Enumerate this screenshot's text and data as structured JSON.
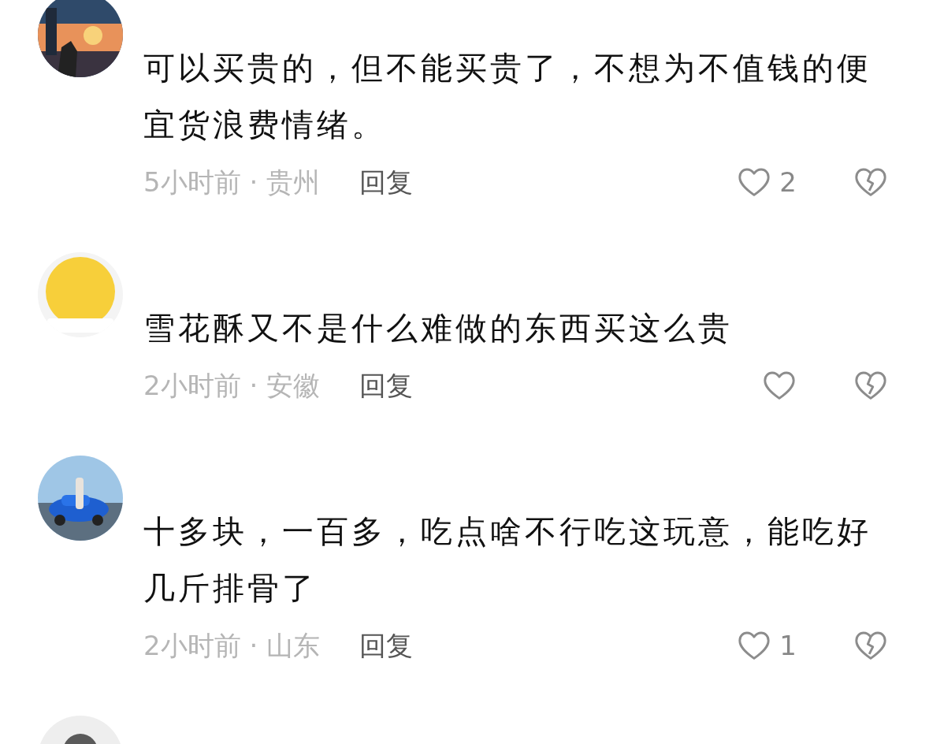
{
  "comments": [
    {
      "text": "可以买贵的，但不能买贵了，不想为不值钱的便宜货浪费情绪。",
      "time_location": "5小时前 · 贵州",
      "reply": "回复",
      "likes": "2",
      "liked": false
    },
    {
      "text": "雪花酥又不是什么难做的东西买这么贵",
      "time_location": "2小时前 · 安徽",
      "reply": "回复",
      "liked": false
    },
    {
      "text": "十多块，一百多，吃点啥不行吃这玩意，能吃好几斤排骨了",
      "time_location": "2小时前 · 山东",
      "reply": "回复",
      "likes": "1",
      "liked": false
    }
  ]
}
